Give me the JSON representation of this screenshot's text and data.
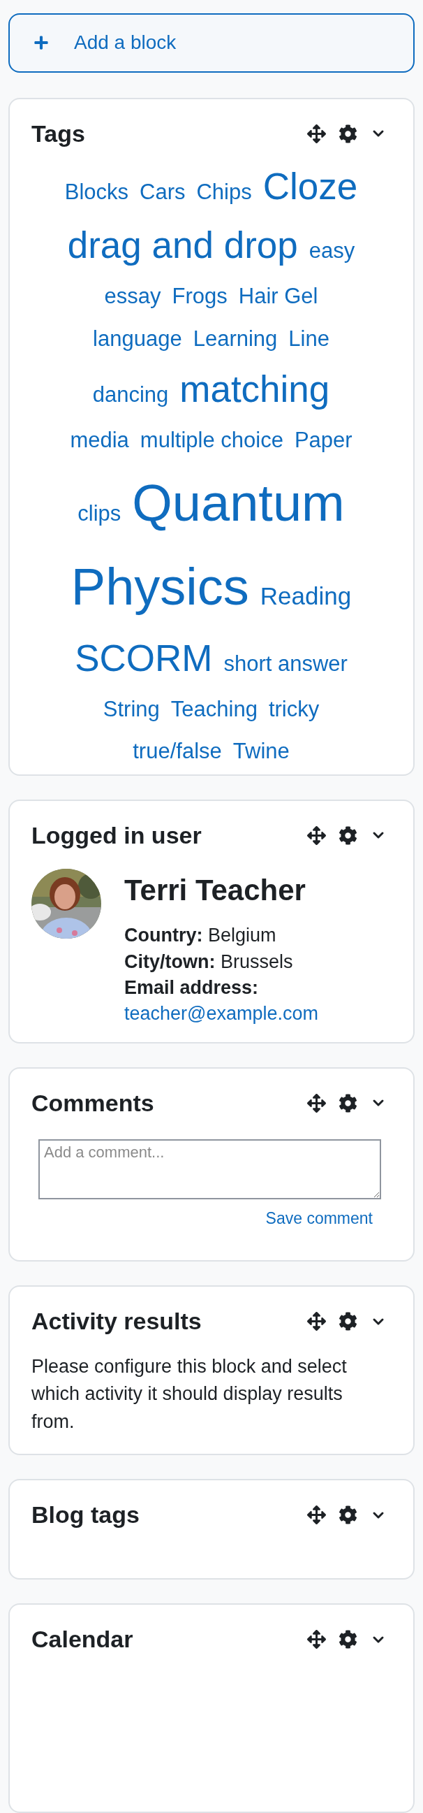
{
  "add_block": {
    "label": "Add a block"
  },
  "blocks": [
    {
      "kind": "tags",
      "title": "Tags",
      "rows": [
        [
          {
            "label": "Blocks",
            "kind": "normal"
          },
          {
            "label": "Cars",
            "kind": "normal"
          },
          {
            "label": "Chips",
            "kind": "normal"
          },
          {
            "label": "Cloze",
            "kind": "large"
          }
        ],
        [
          {
            "label": "drag and drop",
            "kind": "large"
          },
          {
            "label": "easy",
            "kind": "normal"
          }
        ],
        [
          {
            "label": "essay",
            "kind": "normal"
          },
          {
            "label": "Frogs",
            "kind": "normal"
          },
          {
            "label": "Hair Gel",
            "kind": "normal"
          }
        ],
        [
          {
            "label": "language",
            "kind": "normal"
          },
          {
            "label": "Learning",
            "kind": "normal"
          },
          {
            "label": "Line",
            "kind": "normal"
          }
        ],
        [
          {
            "label": "dancing",
            "kind": "normal"
          },
          {
            "label": "matching",
            "kind": "large"
          }
        ],
        [
          {
            "label": "media",
            "kind": "normal"
          },
          {
            "label": "multiple choice",
            "kind": "normal"
          },
          {
            "label": "Paper",
            "kind": "normal"
          }
        ],
        [
          {
            "label": "clips",
            "kind": "normal"
          },
          {
            "label": "Quantum",
            "kind": "huge"
          }
        ],
        [
          {
            "label": "Physics",
            "kind": "huge"
          },
          {
            "label": "Reading",
            "kind": "medium"
          }
        ],
        [
          {
            "label": "SCORM",
            "kind": "large"
          },
          {
            "label": "short answer",
            "kind": "normal"
          }
        ],
        [
          {
            "label": "String",
            "kind": "normal"
          },
          {
            "label": "Teaching",
            "kind": "normal"
          },
          {
            "label": "tricky",
            "kind": "normal"
          }
        ],
        [
          {
            "label": "true/false",
            "kind": "normal"
          },
          {
            "label": "Twine",
            "kind": "normal"
          }
        ]
      ]
    },
    {
      "kind": "user",
      "title": "Logged in user",
      "avatar": {
        "kind": "picture"
      },
      "name": "Terri Teacher",
      "fields": [
        "**Country:** Belgium",
        "**City/town:** Brussels"
      ],
      "email_label": "Email address:",
      "email": "teacher@example.com"
    },
    {
      "kind": "comments",
      "title": "Comments",
      "placeholder": "Add a comment...",
      "action": "Save comment"
    },
    {
      "kind": "text",
      "title": "Activity results",
      "text": "Please configure this block and select which activity it should display results from."
    },
    {
      "kind": "empty",
      "title": "Blog tags"
    },
    {
      "kind": "cut",
      "title": "Calendar"
    }
  ]
}
